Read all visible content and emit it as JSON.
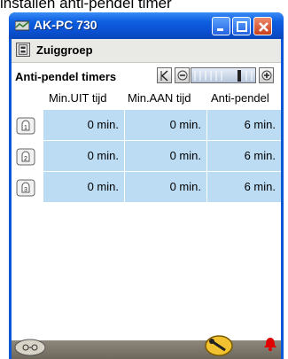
{
  "caption": "installen anti-pendel timer",
  "window": {
    "title": "AK-PC 730"
  },
  "group": {
    "label": "Zuiggroep"
  },
  "section": {
    "label": "Anti-pendel timers"
  },
  "table": {
    "headers": [
      "Min.UIT tijd",
      "Min.AAN tijd",
      "Anti-pendel"
    ],
    "rows": [
      {
        "index": "1",
        "cells": [
          "0 min.",
          "0 min.",
          "6 min."
        ]
      },
      {
        "index": "2",
        "cells": [
          "0 min.",
          "0 min.",
          "6 min."
        ]
      },
      {
        "index": "3",
        "cells": [
          "0 min.",
          "0 min.",
          "6 min."
        ]
      }
    ]
  },
  "colors": {
    "titlebar": "#0a58d8",
    "cell": "#bcdcf4",
    "bottombar": "#7a7468",
    "alarm": "#e00000"
  },
  "icons": [
    "app-icon",
    "minimize-icon",
    "maximize-icon",
    "close-icon",
    "controller-icon",
    "first-page-icon",
    "prev-icon",
    "next-icon",
    "compressor-icon",
    "view-icon",
    "wrench-icon",
    "alarm-bell-icon"
  ]
}
